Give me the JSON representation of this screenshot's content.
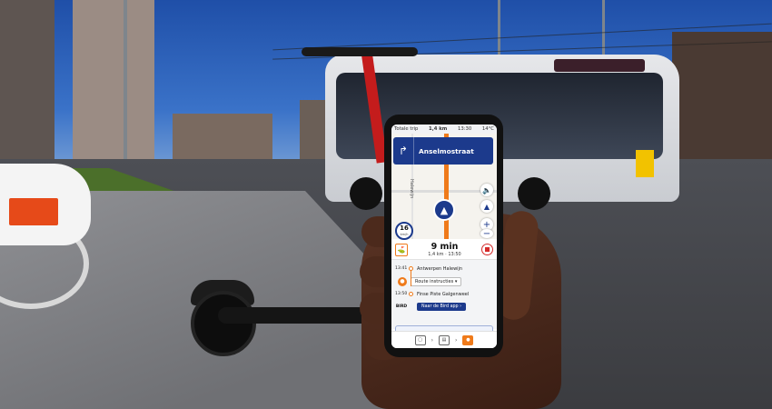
{
  "status_bar": {
    "trip_label": "Totale trip",
    "distance": "1,4 km",
    "clock": "13:30",
    "temp": "14°C"
  },
  "nav": {
    "instruction_distance": "",
    "street": "Anselmostraat",
    "side_street": "Halewijn"
  },
  "map_controls": [
    "sound-icon",
    "compass-icon",
    "zoom-in-icon",
    "zoom-out-icon"
  ],
  "speed": {
    "value": "16",
    "unit": "km/h"
  },
  "trip": {
    "duration": "9 min",
    "summary": "1,4 km · 13:50"
  },
  "itinerary": {
    "start_time": "13:41",
    "start_name": "Antwerpen Halewijn",
    "route_button": "Route instructies",
    "end_time": "13:50",
    "end_name": "Finse Piste Galgenweel",
    "provider": "BIRD",
    "open_app": "Naar de Bird app"
  },
  "colors": {
    "accent": "#ef7a1a",
    "primary": "#1c3a8c",
    "stop": "#d42b2b"
  }
}
